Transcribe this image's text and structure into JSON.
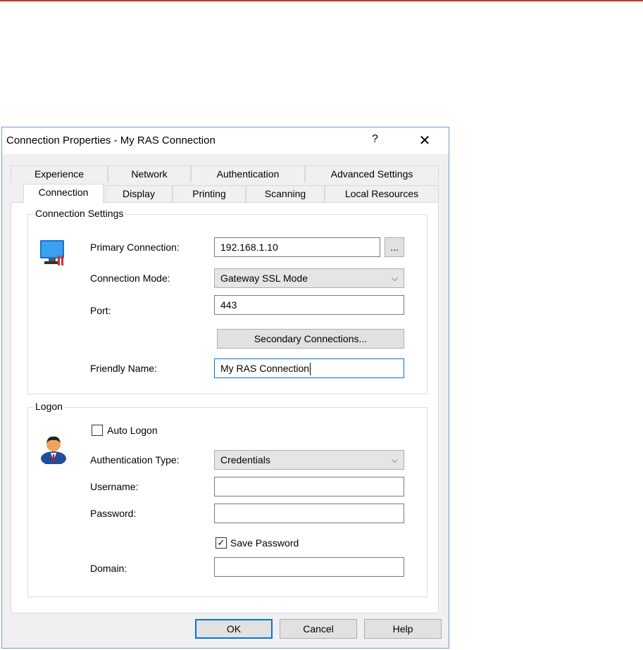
{
  "dialog": {
    "title": "Connection Properties - My RAS Connection",
    "help_glyph": "?",
    "close_glyph": "✕"
  },
  "tabs": {
    "row1": [
      "Experience",
      "Network",
      "Authentication",
      "Advanced Settings"
    ],
    "row2": [
      "Connection",
      "Display",
      "Printing",
      "Scanning",
      "Local Resources"
    ],
    "active": "Connection"
  },
  "connection_settings": {
    "group_label": "Connection Settings",
    "icon": "monitor-icon",
    "primary_label": "Primary Connection:",
    "primary_value": "192.168.1.10",
    "browse_label": "...",
    "mode_label": "Connection Mode:",
    "mode_value": "Gateway SSL Mode",
    "port_label": "Port:",
    "port_value": "443",
    "secondary_button": "Secondary Connections...",
    "friendly_label": "Friendly Name:",
    "friendly_value": "My RAS Connection"
  },
  "logon": {
    "group_label": "Logon",
    "icon": "user-icon",
    "auto_logon_label": "Auto Logon",
    "auto_logon_checked": false,
    "auth_type_label": "Authentication Type:",
    "auth_type_value": "Credentials",
    "username_label": "Username:",
    "username_value": "",
    "password_label": "Password:",
    "password_value": "",
    "save_password_label": "Save Password",
    "save_password_checked": true,
    "domain_label": "Domain:",
    "domain_value": ""
  },
  "buttons": {
    "ok": "OK",
    "cancel": "Cancel",
    "help": "Help"
  },
  "colors": {
    "accent": "#0078d7",
    "top_line": "#c0392b"
  }
}
